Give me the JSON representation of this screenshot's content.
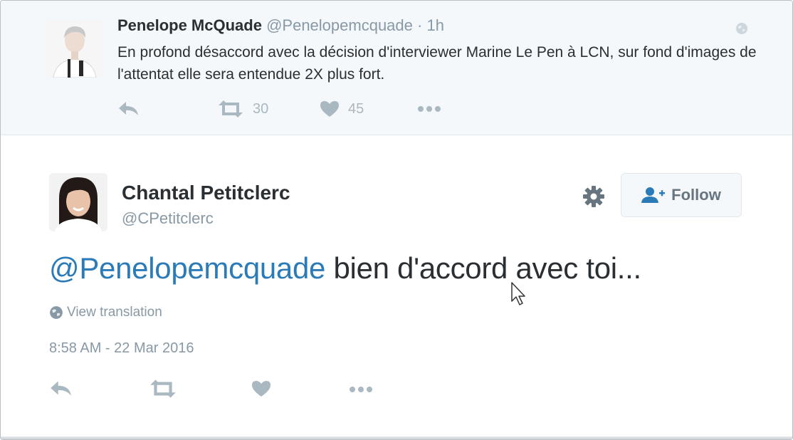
{
  "parent_tweet": {
    "name": "Penelope McQuade",
    "handle": "@Penelopemcquade",
    "time": "· 1h",
    "text": "En profond désaccord avec la décision d'interviewer Marine Le Pen à  LCN, sur fond d'images de l'attentat elle sera entendue 2X plus fort.",
    "retweets": "30",
    "likes": "45"
  },
  "main_tweet": {
    "name": "Chantal Petitclerc",
    "handle": "@CPetitclerc",
    "follow_label": "Follow",
    "mention": "@Penelopemcquade",
    "text": " bien d'accord avec toi...",
    "translation_label": "View translation",
    "timestamp": "8:58 AM - 22 Mar 2016"
  },
  "icons": {
    "reply": "reply-icon",
    "retweet": "retweet-icon",
    "like": "heart-icon",
    "more": "more-icon",
    "settings": "gear-icon",
    "follow": "follow-user-icon",
    "globe": "globe-icon"
  },
  "colors": {
    "link": "#2b7bb9",
    "muted": "#8899a6",
    "action_icon": "#aab8c2",
    "text": "#292f33",
    "parent_bg": "#f5f8fa"
  }
}
